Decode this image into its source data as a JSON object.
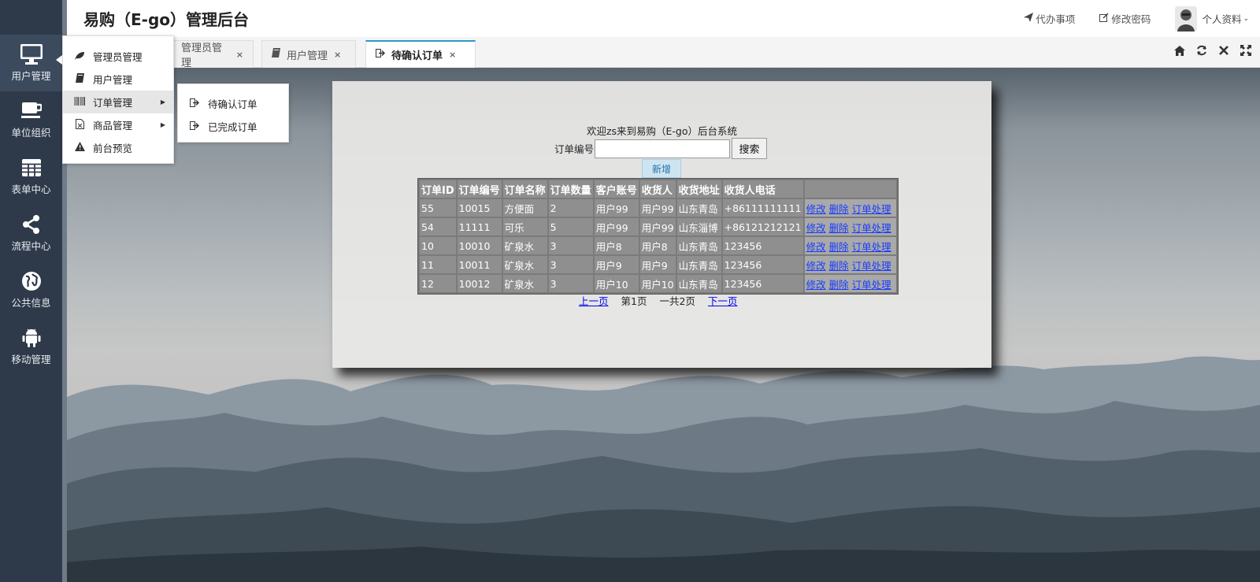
{
  "header": {
    "title": "易购（E-go）管理后台",
    "links": [
      {
        "icon": "paper-plane-icon",
        "label": "代办事项"
      },
      {
        "icon": "edit-icon",
        "label": "修改密码"
      }
    ],
    "profile_label": "个人资料"
  },
  "tabs": [
    {
      "label": "管理员管理",
      "close": "×",
      "active": false
    },
    {
      "label": "用户管理",
      "close": "×",
      "active": false
    },
    {
      "label": "待确认订单",
      "close": "×",
      "active": true
    }
  ],
  "sidebar": {
    "items": [
      {
        "label": "用户管理",
        "icon": "monitor-icon"
      },
      {
        "label": "单位组织",
        "icon": "coffee-icon"
      },
      {
        "label": "表单中心",
        "icon": "table-icon"
      },
      {
        "label": "流程中心",
        "icon": "share-icon"
      },
      {
        "label": "公共信息",
        "icon": "globe-icon"
      },
      {
        "label": "移动管理",
        "icon": "android-icon"
      }
    ]
  },
  "flyout": {
    "items": [
      {
        "label": "管理员管理",
        "icon": "leaf-icon"
      },
      {
        "label": "用户管理",
        "icon": "book-icon"
      },
      {
        "label": "订单管理",
        "icon": "barcode-icon"
      },
      {
        "label": "商品管理",
        "icon": "file-icon"
      },
      {
        "label": "前台预览",
        "icon": "warning-icon"
      }
    ],
    "submenu": [
      {
        "label": "待确认订单",
        "icon": "signout-icon"
      },
      {
        "label": "已完成订单",
        "icon": "signout-icon"
      }
    ]
  },
  "panel": {
    "welcome": "欢迎zs来到易购（E-go）后台系统",
    "search_label": "订单编号",
    "search_value": "",
    "search_button": "搜索",
    "new_button": "新增",
    "columns": [
      "订单ID",
      "订单编号",
      "订单名称",
      "订单数量",
      "客户账号",
      "收货人",
      "收货地址",
      "收货人电话"
    ],
    "rows": [
      [
        "55",
        "10015",
        "方便面",
        "2",
        "用户99",
        "用户99",
        "山东青岛",
        "+86111111111"
      ],
      [
        "54",
        "11111",
        "可乐",
        "5",
        "用户99",
        "用户99",
        "山东淄博",
        "+86121212121"
      ],
      [
        "10",
        "10010",
        "矿泉水",
        "3",
        "用户8",
        "用户8",
        "山东青岛",
        "123456"
      ],
      [
        "11",
        "10011",
        "矿泉水",
        "3",
        "用户9",
        "用户9",
        "山东青岛",
        "123456"
      ],
      [
        "12",
        "10012",
        "矿泉水",
        "3",
        "用户10",
        "用户10",
        "山东青岛",
        "123456"
      ]
    ],
    "row_actions": [
      "修改",
      "删除",
      "订单处理"
    ],
    "pager": {
      "prev": "上一页",
      "current": "第1页",
      "total": "一共2页",
      "next": "下一页"
    }
  }
}
